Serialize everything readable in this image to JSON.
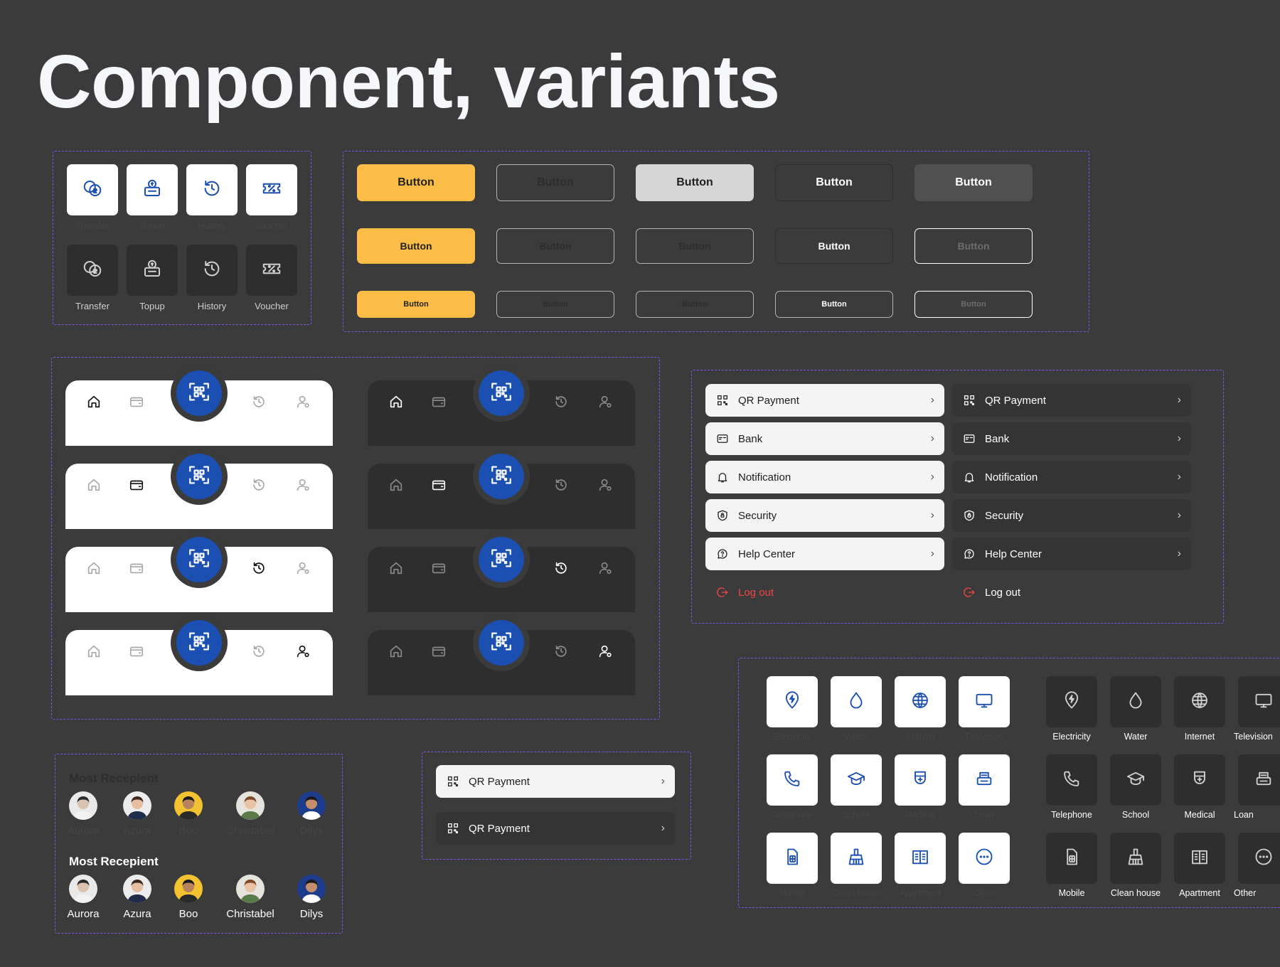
{
  "page": {
    "title": "Component, variants"
  },
  "colors": {
    "accent_yellow": "#fbbd45",
    "brand_blue": "#1b4fb1",
    "danger_red": "#ef4444",
    "frame_purple": "#8154e8"
  },
  "quick_actions": {
    "light": [
      {
        "label": "Transfer",
        "icon": "money-transfer-icon"
      },
      {
        "label": "Topup",
        "icon": "topup-icon"
      },
      {
        "label": "History",
        "icon": "history-icon"
      },
      {
        "label": "voucher",
        "icon": "voucher-icon"
      }
    ],
    "dark": [
      {
        "label": "Transfer",
        "icon": "money-transfer-icon"
      },
      {
        "label": "Topup",
        "icon": "topup-icon"
      },
      {
        "label": "History",
        "icon": "history-icon"
      },
      {
        "label": "Voucher",
        "icon": "voucher-icon"
      }
    ]
  },
  "buttons": {
    "label": "Button"
  },
  "bottom_nav": {
    "icons": [
      "home-icon",
      "wallet-icon",
      "qr-scan-icon",
      "history-icon",
      "profile-icon"
    ],
    "active_items": [
      "home",
      "wallet",
      "history",
      "profile"
    ]
  },
  "menu": {
    "items": [
      {
        "label": "QR Payment",
        "icon": "qr-icon"
      },
      {
        "label": "Bank",
        "icon": "bank-card-icon"
      },
      {
        "label": "Notification",
        "icon": "bell-icon"
      },
      {
        "label": "Security",
        "icon": "shield-icon"
      },
      {
        "label": "Help Center",
        "icon": "help-chat-icon"
      }
    ],
    "logout": {
      "label": "Log out",
      "icon": "logout-icon"
    }
  },
  "qr_rows": [
    "QR Payment",
    "QR Payment"
  ],
  "recipients": {
    "heading": "Most Recepient",
    "people": [
      "Aurora",
      "Azura",
      "Boo",
      "Christabel",
      "Dilys"
    ]
  },
  "bills": [
    {
      "label": "Electricity",
      "icon": "electricity-icon"
    },
    {
      "label": "Water",
      "icon": "water-drop-icon"
    },
    {
      "label": "Internet",
      "icon": "globe-icon"
    },
    {
      "label": "Television",
      "icon": "tv-icon"
    },
    {
      "label": "Telephone",
      "icon": "phone-icon"
    },
    {
      "label": "School",
      "icon": "graduation-cap-icon"
    },
    {
      "label": "Medical",
      "icon": "medical-icon"
    },
    {
      "label": "Loan",
      "icon": "loan-icon"
    },
    {
      "label": "Mobile",
      "icon": "mobile-sim-icon"
    },
    {
      "label": "Clean house",
      "icon": "cleaning-icon"
    },
    {
      "label": "Apartment",
      "icon": "apartment-icon"
    },
    {
      "label": "Other",
      "icon": "more-icon"
    }
  ]
}
